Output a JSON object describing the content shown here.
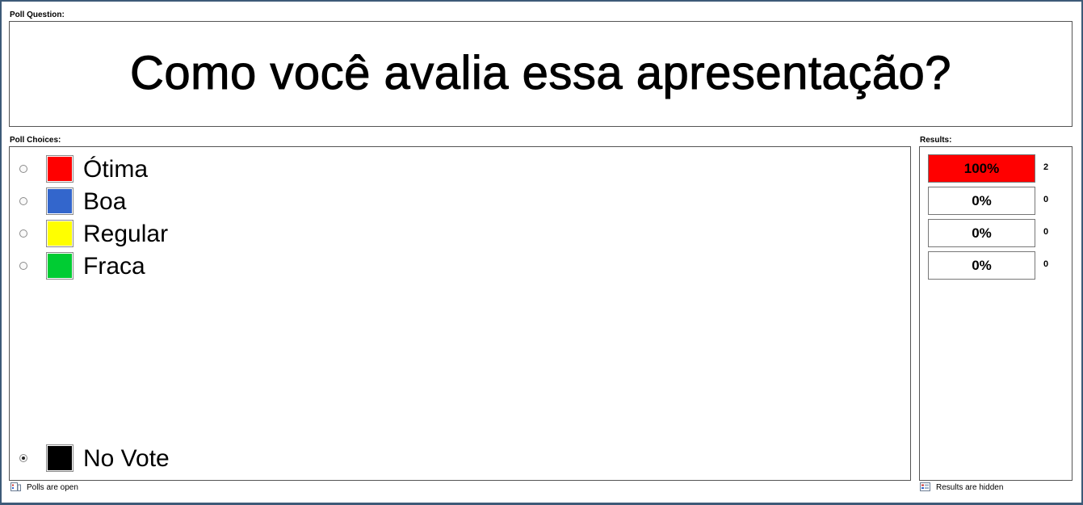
{
  "poll_question": {
    "label": "Poll Question:",
    "text": "Como você avalia essa apresentação?"
  },
  "poll_choices": {
    "label": "Poll Choices:",
    "items": [
      {
        "label": "Ótima",
        "color": "#ff0000",
        "selected": false
      },
      {
        "label": "Boa",
        "color": "#3366cc",
        "selected": false
      },
      {
        "label": "Regular",
        "color": "#ffff00",
        "selected": false
      },
      {
        "label": "Fraca",
        "color": "#00cc33",
        "selected": false
      }
    ],
    "no_vote": {
      "label": "No Vote",
      "color": "#000000",
      "selected": true
    }
  },
  "results": {
    "label": "Results:",
    "highlight_color": "#ff0000",
    "items": [
      {
        "percent": "100%",
        "count": "2",
        "share": 1.0
      },
      {
        "percent": "0%",
        "count": "0",
        "share": 0.0
      },
      {
        "percent": "0%",
        "count": "0",
        "share": 0.0
      },
      {
        "percent": "0%",
        "count": "0",
        "share": 0.0
      }
    ]
  },
  "status": {
    "polls": "Polls are open",
    "results": "Results are hidden"
  }
}
